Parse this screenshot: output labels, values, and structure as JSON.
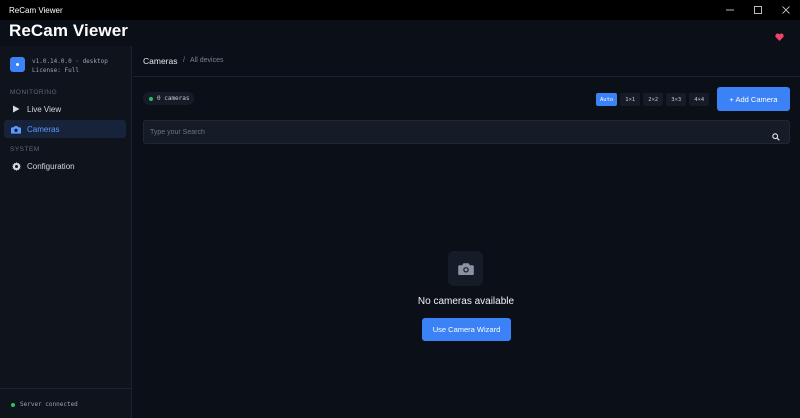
{
  "window": {
    "title": "ReCam Viewer",
    "controls": [
      "minimize-icon",
      "maximize-icon",
      "close-icon"
    ]
  },
  "app": {
    "title": "ReCam Viewer",
    "favorite_icon": "heart-icon",
    "accent": "#3b82f6",
    "favorite_color": "#ef4466"
  },
  "sidebar": {
    "version": "v1.0.14.0.0 · desktop",
    "license": "License: Full",
    "sections": [
      {
        "label": "MONITORING",
        "items": [
          {
            "label": "Live View",
            "icon": "play-icon",
            "active": false
          },
          {
            "label": "Cameras",
            "icon": "camera-icon",
            "active": true
          }
        ]
      },
      {
        "label": "SYSTEM",
        "items": [
          {
            "label": "Configuration",
            "icon": "gear-icon",
            "active": false
          }
        ]
      }
    ],
    "status": {
      "text": "Server connected",
      "color": "#22c55e"
    }
  },
  "main": {
    "breadcrumb": {
      "title": "Cameras",
      "separator": "/",
      "sub": "All devices"
    },
    "camera_count": "0 cameras",
    "layouts": [
      {
        "label": "Auto",
        "active": true
      },
      {
        "label": "1×1",
        "active": false
      },
      {
        "label": "2×2",
        "active": false
      },
      {
        "label": "3×3",
        "active": false
      },
      {
        "label": "4×4",
        "active": false
      }
    ],
    "add_button": "+ Add Camera",
    "search": {
      "placeholder": "Type your Search",
      "value": ""
    },
    "empty_state": {
      "icon": "camera-icon",
      "text": "No cameras available",
      "button": "Use Camera Wizard"
    }
  }
}
